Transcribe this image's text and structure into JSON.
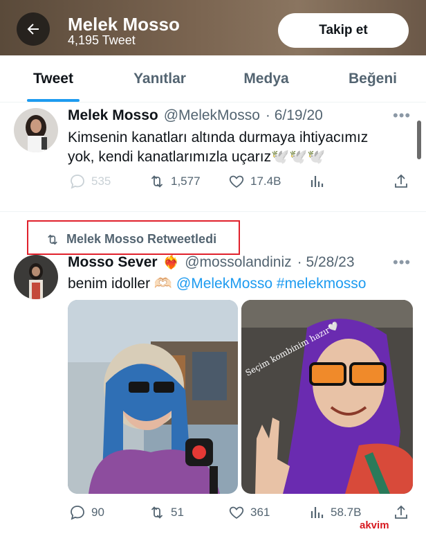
{
  "header": {
    "name": "Melek Mosso",
    "tweet_count": "4,195 Tweet",
    "follow_label": "Takip et"
  },
  "tabs": [
    {
      "label": "Tweet",
      "active": true
    },
    {
      "label": "Yanıtlar",
      "active": false
    },
    {
      "label": "Medya",
      "active": false
    },
    {
      "label": "Beğeni",
      "active": false
    }
  ],
  "tweets": [
    {
      "name": "Melek Mosso",
      "handle": "@MelekMosso",
      "date": "· 6/19/20",
      "text_line1": "Kimsenin kanatları altında durmaya ihtiyacımız",
      "text_line2": "yok, kendi kanatlarımızla uçarız🕊️🕊️🕊️",
      "replies": "535",
      "retweets": "1,577",
      "likes": "17.4B",
      "more": "•••"
    },
    {
      "retweeted_by": "Melek Mosso Retweetledi",
      "name": "Mosso Sever",
      "name_emoji": "❤️‍🔥",
      "handle": "@mossolandiniz",
      "date": "· 5/28/23",
      "text_plain": "benim idoller 🫶🏻",
      "text_mention": "@MelekMosso",
      "text_hashtag": "#melekmosso",
      "media_caption": "Seçim kombinim hazır🤍",
      "replies": "90",
      "retweets": "51",
      "likes": "361",
      "views": "58.7B",
      "more": "•••"
    }
  ],
  "watermark": "akvim",
  "colors": {
    "accent": "#1d9bf0",
    "highlight_box": "#e0202b",
    "muted": "#536471"
  }
}
